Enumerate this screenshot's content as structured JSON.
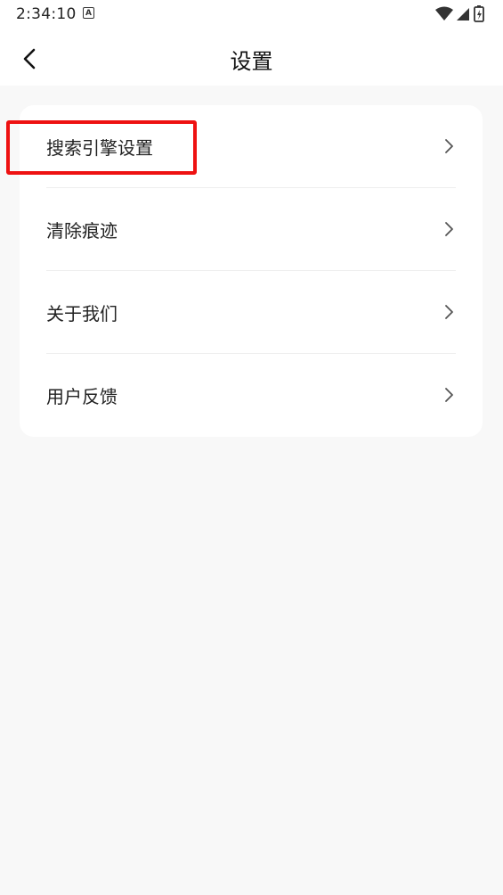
{
  "status_bar": {
    "time": "2:34:10",
    "notification_badge": "A",
    "icons": [
      "wifi-icon",
      "signal-icon",
      "battery-icon"
    ]
  },
  "header": {
    "title": "设置",
    "back_icon": "chevron-left-icon"
  },
  "settings": {
    "items": [
      {
        "label": "搜索引擎设置",
        "icon": "chevron-right-icon"
      },
      {
        "label": "清除痕迹",
        "icon": "chevron-right-icon"
      },
      {
        "label": "关于我们",
        "icon": "chevron-right-icon"
      },
      {
        "label": "用户反馈",
        "icon": "chevron-right-icon"
      }
    ]
  },
  "colors": {
    "background": "#f8f8f8",
    "card": "#ffffff",
    "highlight": "#ee1111"
  }
}
